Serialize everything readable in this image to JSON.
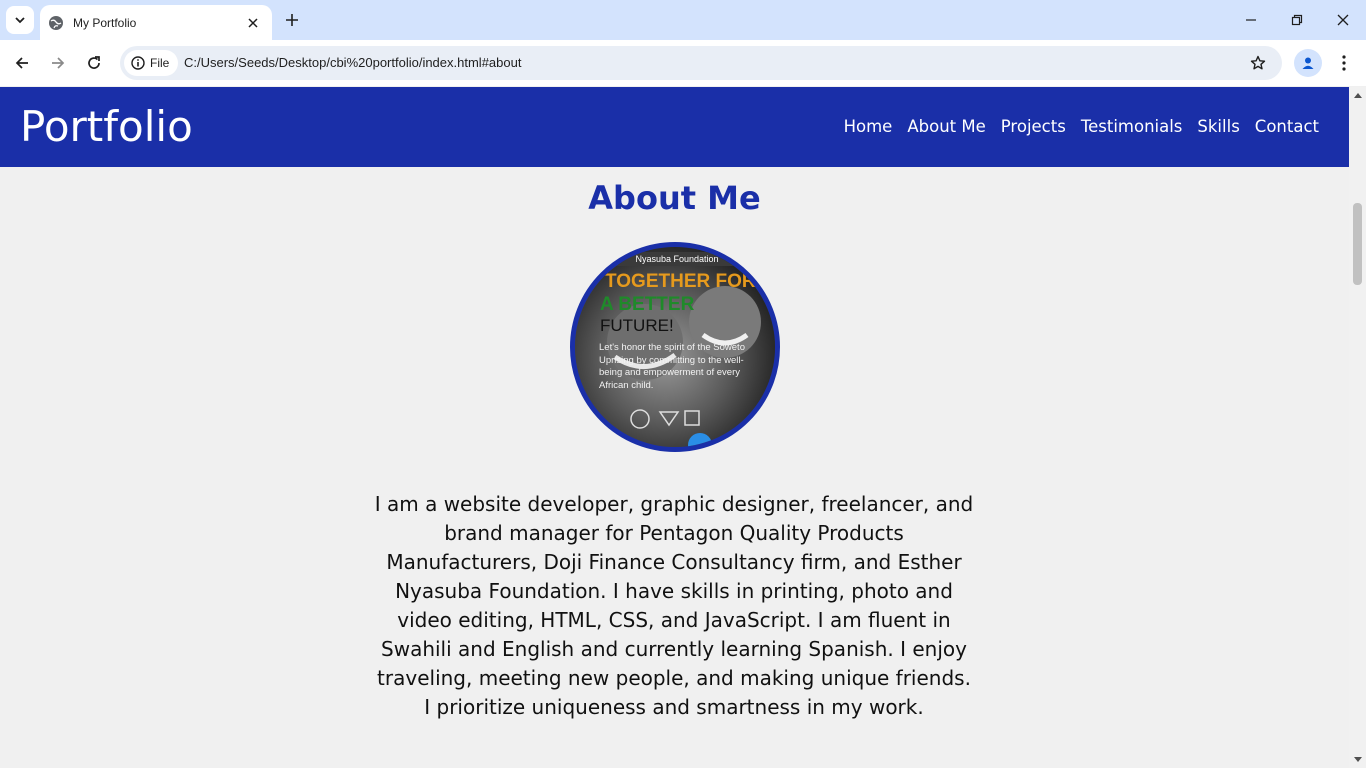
{
  "browser": {
    "tab_title": "My Portfolio",
    "site_chip_label": "File",
    "url": "C:/Users/Seeds/Desktop/cbi%20portfolio/index.html#about"
  },
  "site": {
    "logo": "Portfolio",
    "nav": [
      "Home",
      "About Me",
      "Projects",
      "Testimonials",
      "Skills",
      "Contact"
    ]
  },
  "about": {
    "title": "About Me",
    "image_lines": {
      "org": "Nyasuba Foundation",
      "headline1": "TOGETHER FOR",
      "headline2": "A BETTER",
      "headline3": "FUTURE!",
      "body": "Let's honor the spirit of the Soweto Uprising by committing to the well-being and empowerment of every African child."
    },
    "bio": "I am a website developer, graphic designer, freelancer, and brand manager for Pentagon Quality Products Manufacturers, Doji Finance Consultancy firm, and Esther Nyasuba Foundation. I have skills in printing, photo and video editing, HTML, CSS, and JavaScript. I am fluent in Swahili and English and currently learning Spanish. I enjoy traveling, meeting new people, and making unique friends. I prioritize uniqueness and smartness in my work."
  },
  "colors": {
    "brand_blue": "#1a2fa8",
    "page_bg": "#f0f0f0",
    "chrome_tab_strip": "#d3e3fd"
  }
}
